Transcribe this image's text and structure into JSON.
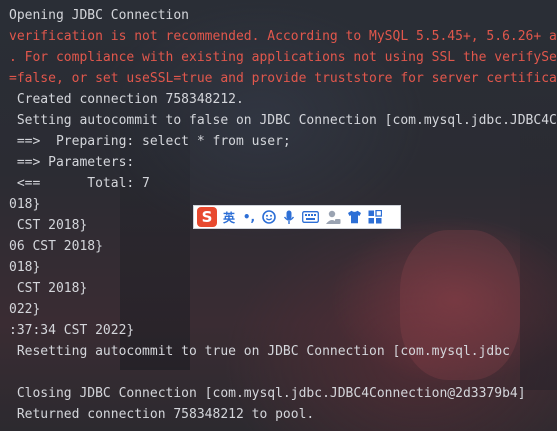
{
  "console": {
    "lines": [
      {
        "text": "Opening JDBC Connection",
        "color": "#d4d6db"
      },
      {
        "text": "verification is not recommended. According to MySQL 5.5.45+, 5.6.26+ a",
        "color": "#e1574c"
      },
      {
        "text": ". For compliance with existing applications not using SSL the verifySe",
        "color": "#e1574c"
      },
      {
        "text": "=false, or set useSSL=true and provide truststore for server certifica",
        "color": "#e1574c"
      },
      {
        "text": " Created connection 758348212.",
        "color": "#d4d6db"
      },
      {
        "text": " Setting autocommit to false on JDBC Connection [com.mysql.jdbc.JDBC4C",
        "color": "#d4d6db"
      },
      {
        "text": " ==>  Preparing: select * from user;",
        "color": "#d4d6db"
      },
      {
        "text": " ==> Parameters: ",
        "color": "#d4d6db"
      },
      {
        "text": " <==      Total: 7",
        "color": "#d4d6db"
      },
      {
        "text": "018}",
        "color": "#d4d6db"
      },
      {
        "text": " CST 2018}",
        "color": "#d4d6db"
      },
      {
        "text": "06 CST 2018}",
        "color": "#d4d6db"
      },
      {
        "text": "018}",
        "color": "#d4d6db"
      },
      {
        "text": " CST 2018}",
        "color": "#d4d6db"
      },
      {
        "text": "022}",
        "color": "#d4d6db"
      },
      {
        "text": ":37:34 CST 2022}",
        "color": "#d4d6db"
      },
      {
        "text": " Resetting autocommit to true on JDBC Connection [com.mysql.jdbc",
        "color": "#d4d6db"
      },
      {
        "text": "",
        "color": "#d4d6db"
      },
      {
        "text": " Closing JDBC Connection [com.mysql.jdbc.JDBC4Connection@2d3379b4]",
        "color": "#d4d6db"
      },
      {
        "text": " Returned connection 758348212 to pool.",
        "color": "#d4d6db"
      }
    ]
  },
  "ime_toolbar": {
    "logo": "S",
    "lang": "英",
    "punct": "•,",
    "icons": [
      "emoji-icon",
      "microphone-icon",
      "keyboard-icon",
      "user-icon",
      "shirt-icon",
      "grid-icon"
    ],
    "accent": "#2d6fd6",
    "logo_color": "#e8492f"
  }
}
